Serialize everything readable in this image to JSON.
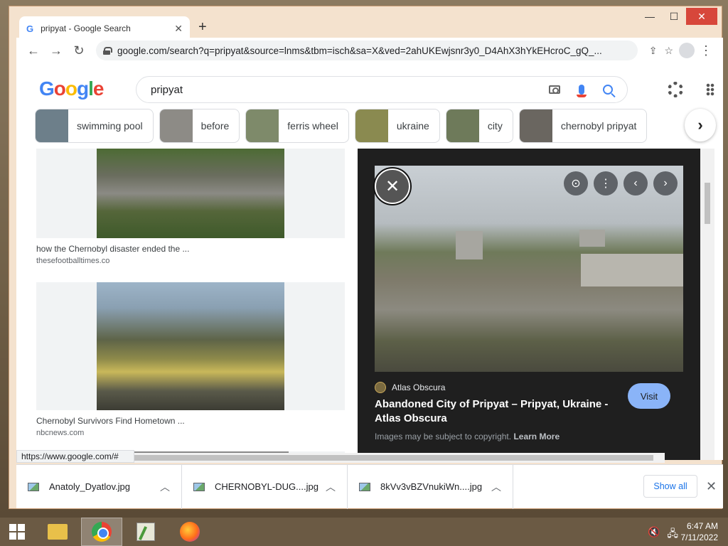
{
  "browser": {
    "tab_title": "pripyat - Google Search",
    "url": "google.com/search?q=pripyat&source=lnms&tbm=isch&sa=X&ved=2ahUKEwjsnr3y0_D4AhX3hYkEHcroC_gQ_..."
  },
  "google": {
    "logo": [
      "G",
      "o",
      "o",
      "g",
      "l",
      "e"
    ],
    "query": "pripyat",
    "chips": [
      {
        "label": "swimming pool",
        "color": "#6d7f8a"
      },
      {
        "label": "before",
        "color": "#8d8b86"
      },
      {
        "label": "ferris wheel",
        "color": "#7e8a6a"
      },
      {
        "label": "ukraine",
        "color": "#8a8a50"
      },
      {
        "label": "city",
        "color": "#6e7a5a"
      },
      {
        "label": "chernobyl pripyat",
        "color": "#6a6660"
      }
    ]
  },
  "results": [
    {
      "caption": "how the Chernobyl disaster ended the ...",
      "site": "thesefootballtimes.co"
    },
    {
      "caption": "Chernobyl Survivors Find Hometown ...",
      "site": "nbcnews.com"
    }
  ],
  "preview": {
    "source": "Atlas Obscura",
    "title": "Abandoned City of Pripyat – Pripyat, Ukraine - Atlas Obscura",
    "visit_label": "Visit",
    "copyright_text": "Images may be subject to copyright.",
    "learn_more": "Learn More"
  },
  "status_url": "https://www.google.com/#",
  "downloads": {
    "items": [
      {
        "name": "Anatoly_Dyatlov.jpg"
      },
      {
        "name": "CHERNOBYL-DUG....jpg"
      },
      {
        "name": "8kVv3vBZVnukiWn....jpg"
      }
    ],
    "show_all": "Show all"
  },
  "taskbar": {
    "time": "6:47 AM",
    "date": "7/11/2022"
  }
}
